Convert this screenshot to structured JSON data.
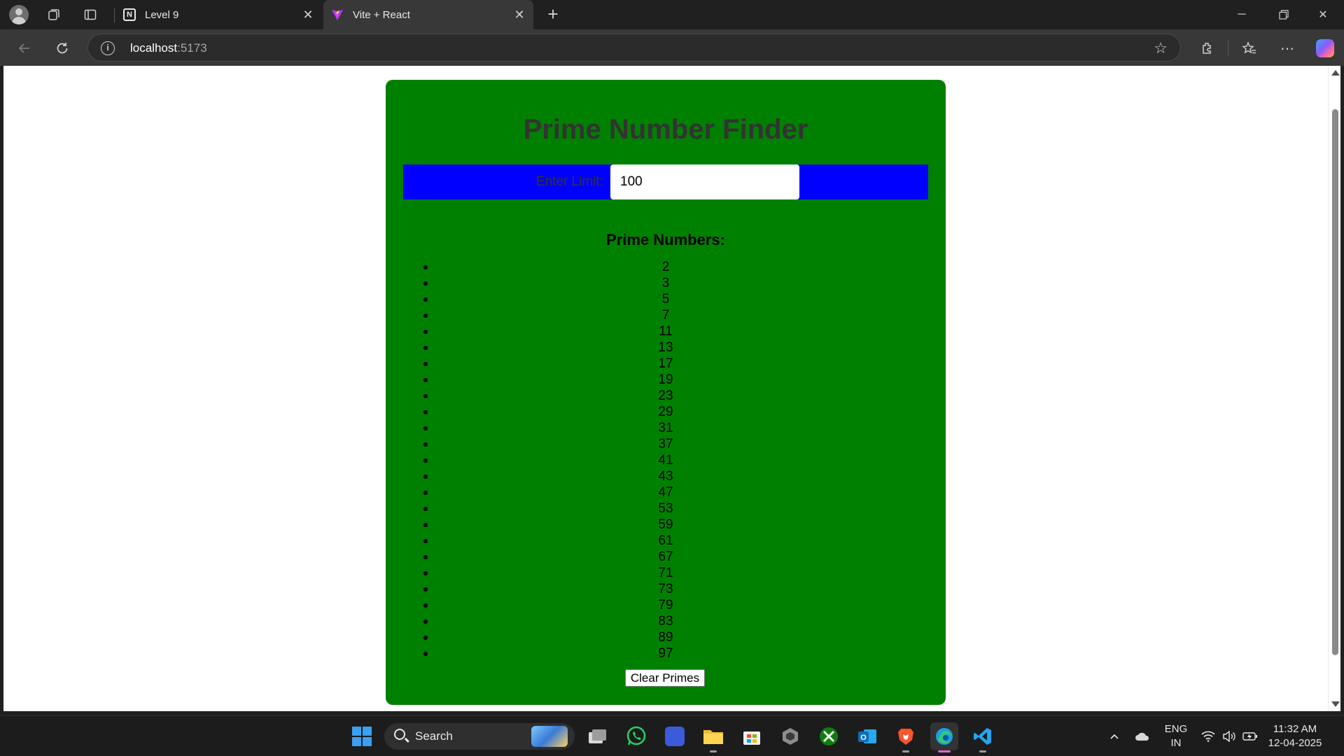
{
  "browser": {
    "tabs": [
      {
        "title": "Level 9",
        "active": false
      },
      {
        "title": "Vite + React",
        "active": true
      }
    ],
    "url_host": "localhost",
    "url_port": ":5173"
  },
  "app": {
    "title": "Prime Number Finder",
    "limit_label": "Enter Limit:",
    "limit_value": "100",
    "list_heading": "Prime Numbers:",
    "primes": [
      "2",
      "3",
      "5",
      "7",
      "11",
      "13",
      "17",
      "19",
      "23",
      "29",
      "31",
      "37",
      "41",
      "43",
      "47",
      "53",
      "59",
      "61",
      "67",
      "71",
      "73",
      "79",
      "83",
      "89",
      "97"
    ],
    "clear_button": "Clear Primes",
    "colors": {
      "card": "#008000",
      "input_row": "#0000ff",
      "title_text": "#333333"
    }
  },
  "taskbar": {
    "search_label": "Search",
    "lang_line1": "ENG",
    "lang_line2": "IN",
    "time": "11:32 AM",
    "date": "12-04-2025"
  }
}
